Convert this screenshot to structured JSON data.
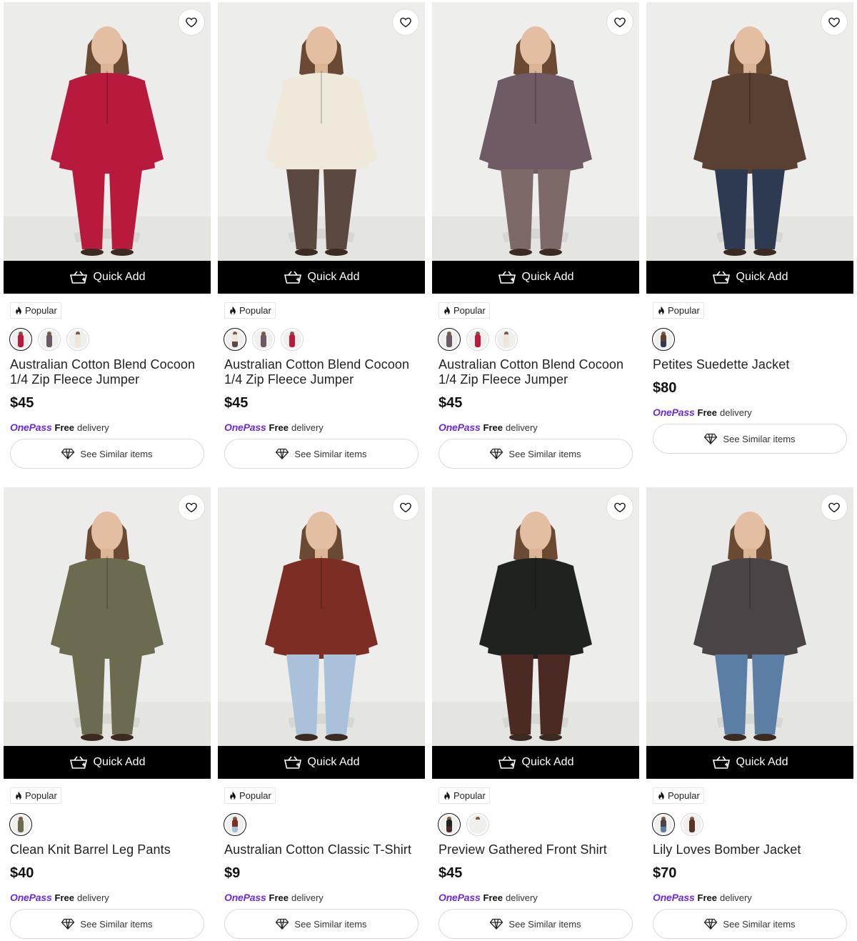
{
  "ui": {
    "quick_add": "Quick Add",
    "popular": "Popular",
    "onepass": "OnePass",
    "free": "Free",
    "delivery": "delivery",
    "see_similar": "See Similar items"
  },
  "products": [
    {
      "name": "Australian Cotton Blend Cocoon 1/4 Zip Fleece Jumper",
      "price": "$45",
      "top_color": "#b81a3e",
      "bottom_color": "#b81a3e",
      "bg": "#ececea",
      "swatches": [
        {
          "top": "#b81a3e",
          "bottom": "#b81a3e",
          "selected": true
        },
        {
          "top": "#6b5a63",
          "bottom": "#6b5a63",
          "selected": false
        },
        {
          "top": "#eee6d8",
          "bottom": "#eee6d8",
          "selected": false
        }
      ]
    },
    {
      "name": "Australian Cotton Blend Cocoon 1/4 Zip Fleece Jumper",
      "price": "$45",
      "top_color": "#efe9dc",
      "bottom_color": "#5b4840",
      "bg": "#ededeb",
      "swatches": [
        {
          "top": "#eee6d8",
          "bottom": "#5b4840",
          "selected": true
        },
        {
          "top": "#6b5a63",
          "bottom": "#6b5a63",
          "selected": false
        },
        {
          "top": "#b81a3e",
          "bottom": "#b81a3e",
          "selected": false
        }
      ]
    },
    {
      "name": "Australian Cotton Blend Cocoon 1/4 Zip Fleece Jumper",
      "price": "$45",
      "top_color": "#6e5b66",
      "bottom_color": "#7d6a68",
      "bg": "#eeeeec",
      "swatches": [
        {
          "top": "#6b5a63",
          "bottom": "#6b5a63",
          "selected": true
        },
        {
          "top": "#b81a3e",
          "bottom": "#b81a3e",
          "selected": false
        },
        {
          "top": "#eee6d8",
          "bottom": "#eee6d8",
          "selected": false
        }
      ]
    },
    {
      "name": "Petites Suedette Jacket",
      "price": "$80",
      "top_color": "#5a3f33",
      "bottom_color": "#2e3a52",
      "bg": "#ededeb",
      "swatches": [
        {
          "top": "#5a3f33",
          "bottom": "#2e3a52",
          "selected": true
        }
      ]
    },
    {
      "name": "Clean Knit Barrel Leg Pants",
      "price": "$40",
      "top_color": "#6d6b4f",
      "bottom_color": "#6d6b4f",
      "bg": "#ececea",
      "swatches": [
        {
          "top": "#6d6b4f",
          "bottom": "#6d6b4f",
          "selected": true
        }
      ]
    },
    {
      "name": "Australian Cotton Classic T-Shirt",
      "price": "$9",
      "top_color": "#7d2e24",
      "bottom_color": "#a9c2da",
      "bg": "#ededeb",
      "swatches": [
        {
          "top": "#7d2e24",
          "bottom": "#a9c2da",
          "selected": true
        }
      ]
    },
    {
      "name": "Preview Gathered Front Shirt",
      "price": "$45",
      "top_color": "#1f221f",
      "bottom_color": "#4b2a24",
      "bg": "#ededeb",
      "swatches": [
        {
          "top": "#1f221f",
          "bottom": "#4b2a24",
          "selected": true
        },
        {
          "top": "#f1efea",
          "bottom": "#f1efea",
          "selected": false
        }
      ]
    },
    {
      "name": "Lily Loves Bomber Jacket",
      "price": "$70",
      "top_color": "#4a4446",
      "bottom_color": "#5c7ea5",
      "bg": "#e9e9e7",
      "swatches": [
        {
          "top": "#4a4446",
          "bottom": "#5c7ea5",
          "selected": true
        },
        {
          "top": "#5a3326",
          "bottom": "#5a3326",
          "selected": false
        }
      ]
    }
  ]
}
